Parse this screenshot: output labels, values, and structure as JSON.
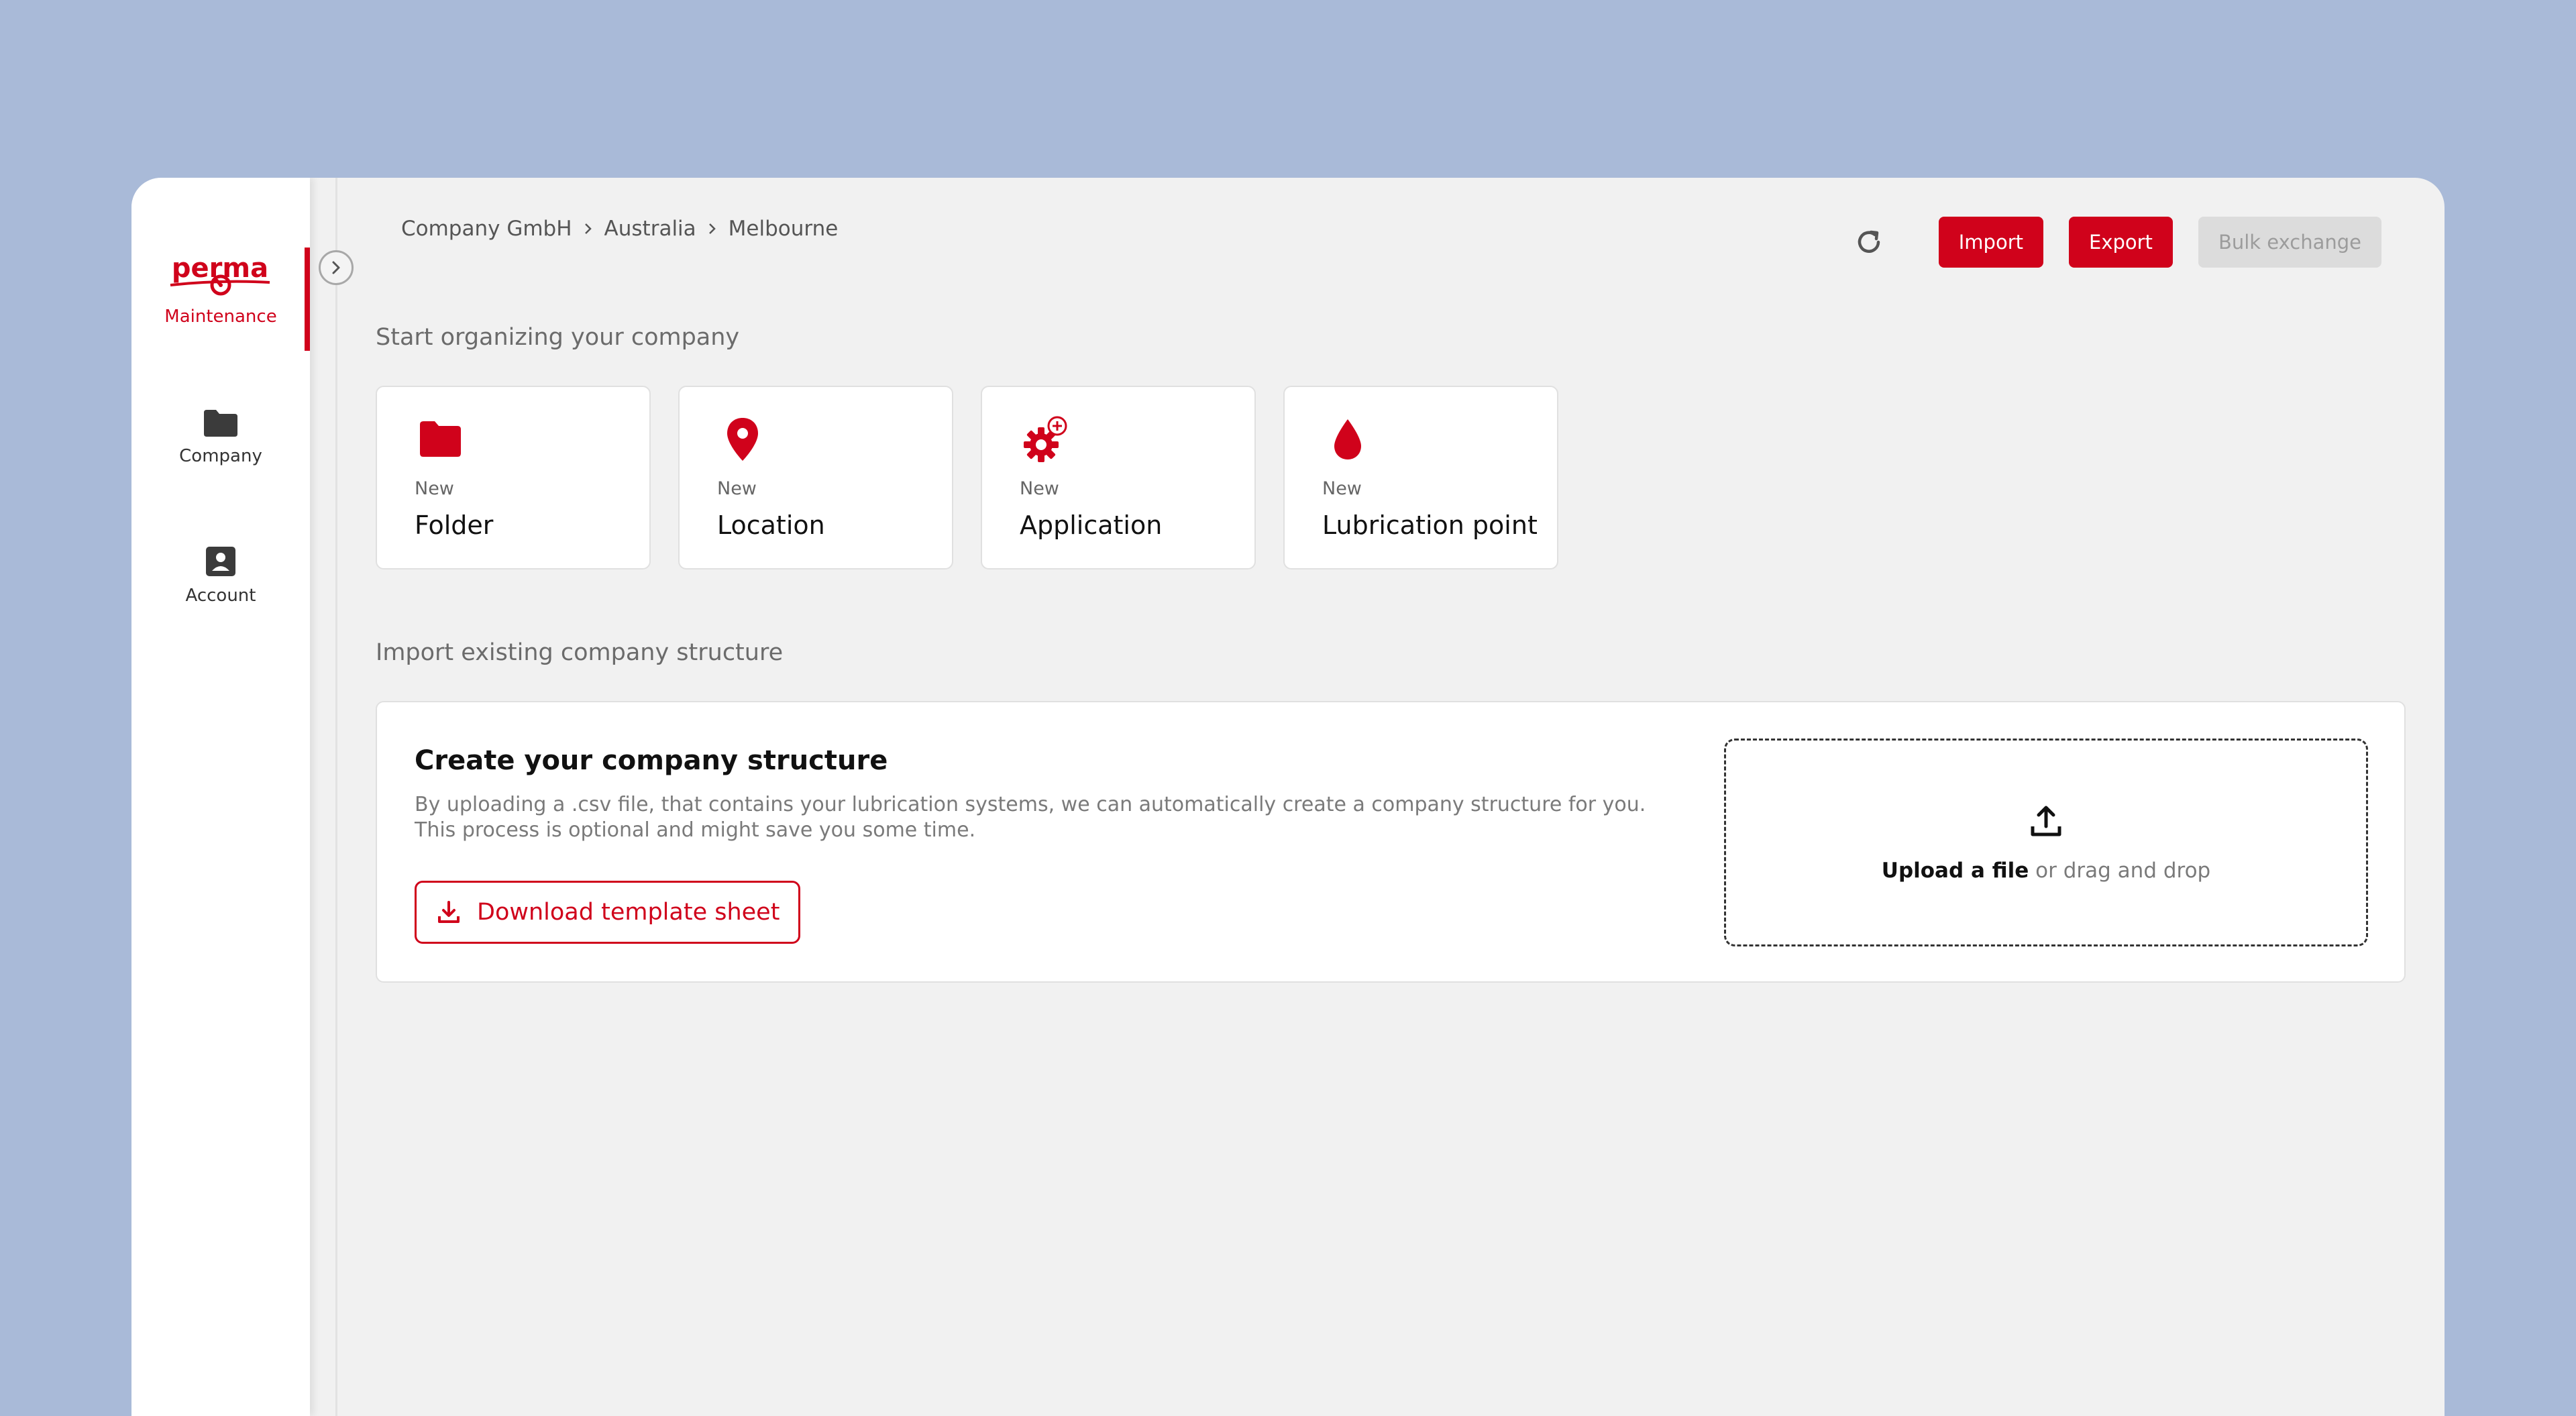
{
  "app": {
    "logo_text": "perma",
    "accent": "#d0021b"
  },
  "sidebar": {
    "items": [
      {
        "label": "Maintenance",
        "icon": "maintenance-icon",
        "active": true
      },
      {
        "label": "Company",
        "icon": "folder-icon",
        "active": false
      },
      {
        "label": "Account",
        "icon": "account-icon",
        "active": false
      }
    ]
  },
  "breadcrumb": [
    "Company GmbH",
    "Australia",
    "Melbourne"
  ],
  "toolbar": {
    "refresh_icon": "refresh-icon",
    "import_label": "Import",
    "export_label": "Export",
    "bulk_label": "Bulk exchange"
  },
  "organize": {
    "title": "Start organizing your company",
    "cards": [
      {
        "prefix": "New",
        "title": "Folder",
        "icon": "folder-icon"
      },
      {
        "prefix": "New",
        "title": "Location",
        "icon": "location-pin-icon"
      },
      {
        "prefix": "New",
        "title": "Application",
        "icon": "gear-add-icon"
      },
      {
        "prefix": "New",
        "title": "Lubrication point",
        "icon": "drop-icon"
      }
    ]
  },
  "import": {
    "section_title": "Import existing company structure",
    "title": "Create your company structure",
    "desc_line1": "By uploading a .csv file, that contains your lubrication systems, we can automatically create a company structure for you.",
    "desc_line2": "This process is optional and might save you some time.",
    "download_label": "Download template sheet",
    "upload_link": "Upload a file",
    "upload_rest": "or drag and drop"
  }
}
